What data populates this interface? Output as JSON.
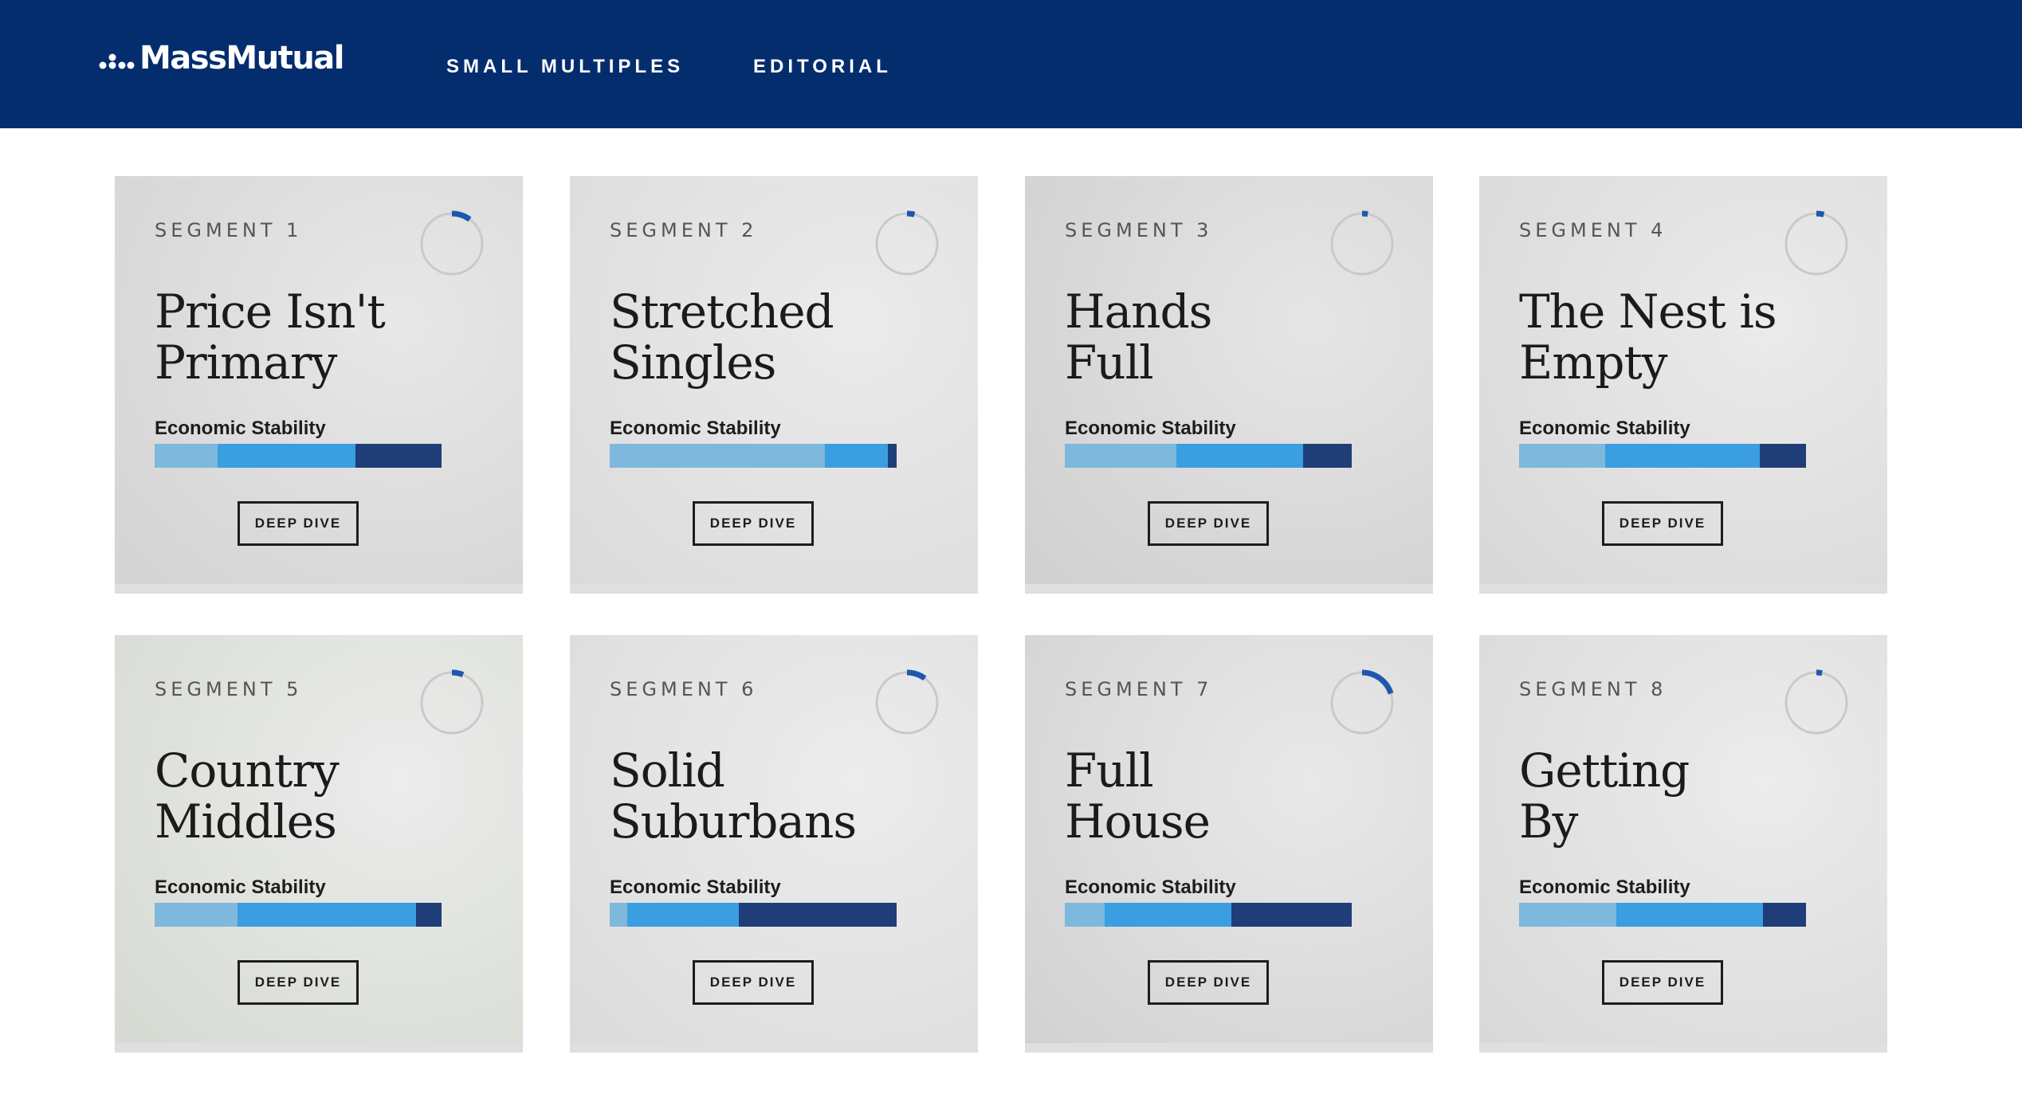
{
  "brand": {
    "name": "MassMutual",
    "logo_icon": "dots-logo-icon",
    "header_color": "#042d6e"
  },
  "nav": {
    "items": [
      {
        "label": "SMALL MULTIPLES"
      },
      {
        "label": "EDITORIAL"
      }
    ]
  },
  "colors": {
    "bar_light": "#7eb8dd",
    "bar_mid": "#3a9ee0",
    "bar_dark": "#1f3d77",
    "ring_accent": "#1f57b0",
    "ring_track": "#c9c9c9"
  },
  "segments": [
    {
      "label": "SEGMENT 1",
      "title_line1": "Price Isn't",
      "title_line2": "Primary",
      "stability_label": "Economic Stability",
      "ring_fraction": 0.1,
      "bar": [
        0.22,
        0.48,
        0.3
      ],
      "button": "DEEP DIVE"
    },
    {
      "label": "SEGMENT 2",
      "title_line1": "Stretched",
      "title_line2": "Singles",
      "stability_label": "Economic Stability",
      "ring_fraction": 0.04,
      "bar": [
        0.75,
        0.22,
        0.03
      ],
      "button": "DEEP DIVE"
    },
    {
      "label": "SEGMENT 3",
      "title_line1": "Hands",
      "title_line2": "Full",
      "stability_label": "Economic Stability",
      "ring_fraction": 0.03,
      "bar": [
        0.39,
        0.44,
        0.17
      ],
      "button": "DEEP DIVE"
    },
    {
      "label": "SEGMENT 4",
      "title_line1": "The Nest is",
      "title_line2": "Empty",
      "stability_label": "Economic Stability",
      "ring_fraction": 0.04,
      "bar": [
        0.3,
        0.54,
        0.16
      ],
      "button": "DEEP DIVE"
    },
    {
      "label": "SEGMENT 5",
      "title_line1": "Country",
      "title_line2": "Middles",
      "stability_label": "Economic Stability",
      "ring_fraction": 0.06,
      "bar": [
        0.29,
        0.62,
        0.09
      ],
      "button": "DEEP DIVE"
    },
    {
      "label": "SEGMENT 6",
      "title_line1": "Solid",
      "title_line2": "Suburbans",
      "stability_label": "Economic Stability",
      "ring_fraction": 0.1,
      "bar": [
        0.06,
        0.39,
        0.55
      ],
      "button": "DEEP DIVE"
    },
    {
      "label": "SEGMENT 7",
      "title_line1": "Full",
      "title_line2": "House",
      "stability_label": "Economic Stability",
      "ring_fraction": 0.2,
      "bar": [
        0.14,
        0.44,
        0.42
      ],
      "button": "DEEP DIVE"
    },
    {
      "label": "SEGMENT 8",
      "title_line1": "Getting",
      "title_line2": "By",
      "stability_label": "Economic Stability",
      "ring_fraction": 0.03,
      "bar": [
        0.34,
        0.51,
        0.15
      ],
      "button": "DEEP DIVE"
    }
  ]
}
